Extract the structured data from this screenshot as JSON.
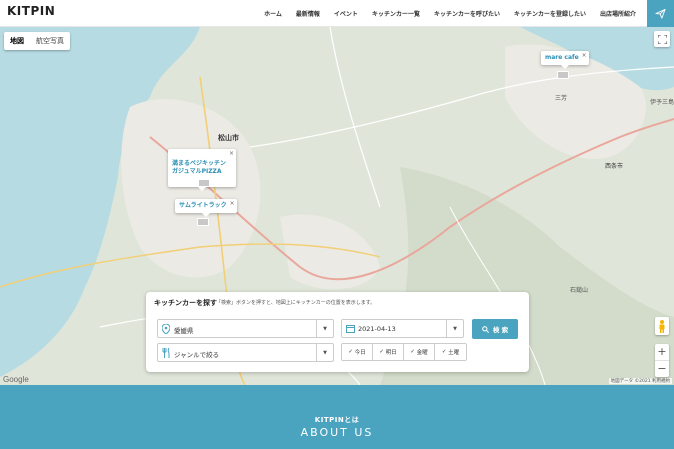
{
  "header": {
    "logo": "KITPIN",
    "nav": [
      "ホーム",
      "最新情報",
      "イベント",
      "キッチンカー一覧",
      "キッチンカーを呼びたい",
      "キッチンカーを登録したい",
      "出店場所紹介"
    ],
    "send_icon": "paper-plane-icon"
  },
  "map": {
    "map_type": [
      "地図",
      "航空写真"
    ],
    "google_label": "Google",
    "attribution": "地図データ ©2021   利用規約",
    "cities": [
      "松山市",
      "西条市"
    ],
    "places": [
      "石鎚山",
      "三芳",
      "伊予三島"
    ],
    "info_windows": [
      {
        "label": "mare cafe"
      },
      {
        "label": "満まるベジキッチン\nガジュマルPIZZA"
      },
      {
        "label": "サムライトラック"
      }
    ],
    "zoom_in": "+",
    "zoom_out": "−"
  },
  "search": {
    "title": "キッチンカーを探す",
    "hint": "「検索」ボタンを押すと、地図上にキッチンカーの位置を表示します。",
    "prefecture": "愛媛県",
    "date": "2021-04-13",
    "genre_placeholder": "ジャンルで絞る",
    "button": "検 索",
    "days": [
      "今日",
      "明日",
      "金曜",
      "土曜"
    ]
  },
  "about": {
    "small": "KITPINとは",
    "big": "ABOUT US"
  }
}
